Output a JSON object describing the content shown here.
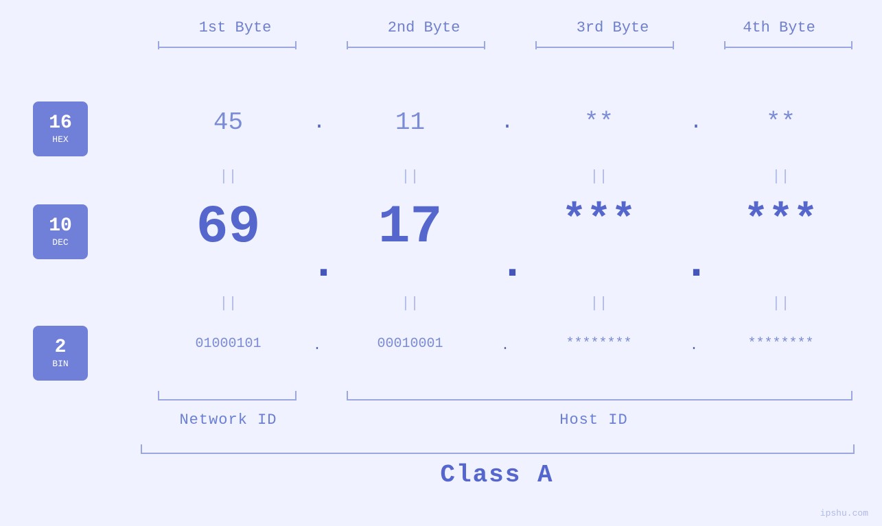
{
  "byte_labels": {
    "b1": "1st Byte",
    "b2": "2nd Byte",
    "b3": "3rd Byte",
    "b4": "4th Byte"
  },
  "bases": {
    "hex": {
      "number": "16",
      "label": "HEX"
    },
    "dec": {
      "number": "10",
      "label": "DEC"
    },
    "bin": {
      "number": "2",
      "label": "BIN"
    }
  },
  "ip": {
    "hex": {
      "b1": "45",
      "b2": "11",
      "b3": "**",
      "b4": "**"
    },
    "dec": {
      "b1": "69",
      "b2": "17",
      "b3": "***",
      "b4": "***"
    },
    "bin": {
      "b1": "01000101",
      "b2": "00010001",
      "b3": "********",
      "b4": "********"
    }
  },
  "labels": {
    "network_id": "Network ID",
    "host_id": "Host ID",
    "class": "Class A"
  },
  "watermark": "ipshu.com",
  "colors": {
    "primary": "#6b7fd4",
    "light": "#a0aee8",
    "bg": "#eef0fb"
  }
}
